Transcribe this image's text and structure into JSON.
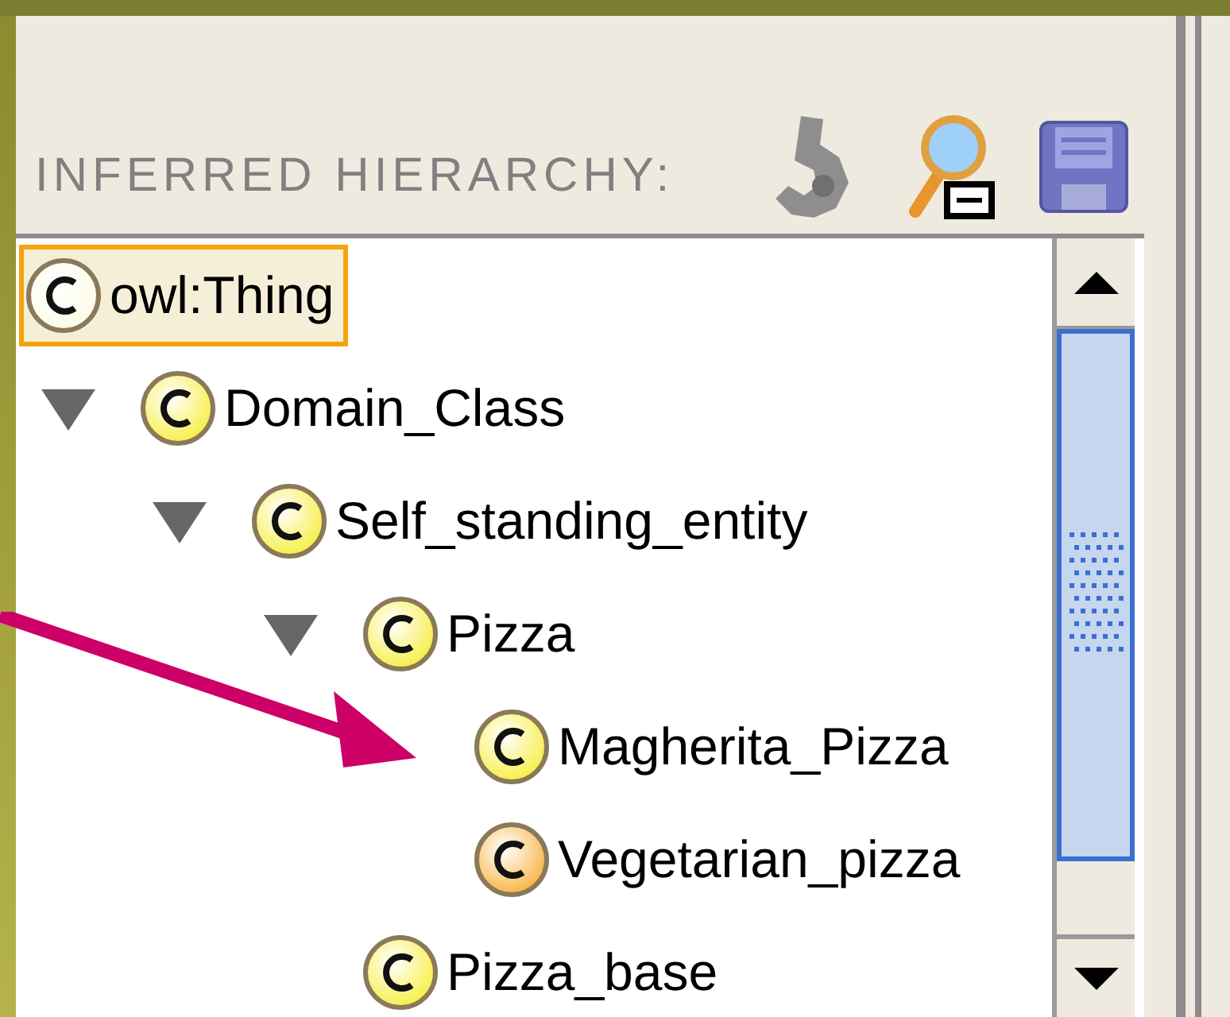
{
  "panel": {
    "title": "INFERRED HIERARCHY:"
  },
  "tree": [
    {
      "label": "owl:Thing",
      "kind": "thing",
      "selected": true,
      "children": [
        {
          "label": "Domain_Class",
          "kind": "primitive",
          "selected": false,
          "expanded": true,
          "children": [
            {
              "label": "Self_standing_entity",
              "kind": "primitive",
              "selected": false,
              "expanded": true,
              "children": [
                {
                  "label": "Pizza",
                  "kind": "primitive",
                  "selected": false,
                  "expanded": true,
                  "children": [
                    {
                      "label": "Magherita_Pizza",
                      "kind": "primitive",
                      "selected": false
                    },
                    {
                      "label": "Vegetarian_pizza",
                      "kind": "defined",
                      "selected": false
                    }
                  ]
                },
                {
                  "label": "Pizza_base",
                  "kind": "primitive",
                  "selected": false
                }
              ]
            }
          ]
        }
      ]
    }
  ]
}
